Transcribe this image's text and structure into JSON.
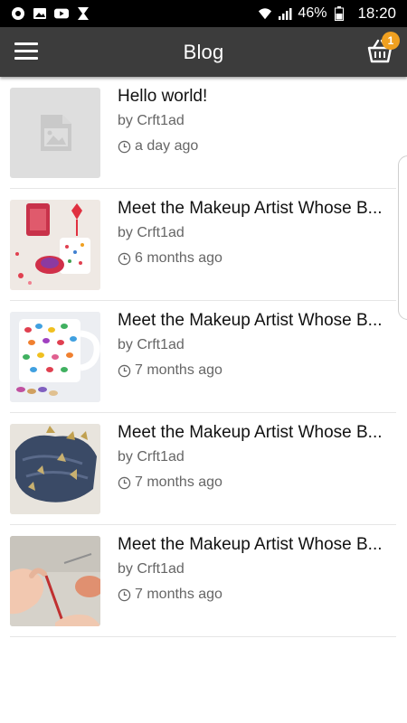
{
  "status_bar": {
    "battery": "46%",
    "time": "18:20"
  },
  "app_bar": {
    "title": "Blog",
    "cart_count": "1",
    "icons": [
      "menu-icon",
      "shopping-basket-icon"
    ]
  },
  "posts": [
    {
      "title": "Hello world!",
      "author": "by Crft1ad",
      "time": "a day ago",
      "thumbnail": "placeholder-image"
    },
    {
      "title": "Meet the Makeup Artist Whose B...",
      "author": "by Crft1ad",
      "time": "6 months ago",
      "thumbnail": "craft-mug-hearts"
    },
    {
      "title": "Meet the Makeup Artist Whose B...",
      "author": "by Crft1ad",
      "time": "7 months ago",
      "thumbnail": "painted-mug"
    },
    {
      "title": "Meet the Makeup Artist Whose B...",
      "author": "by Crft1ad",
      "time": "7 months ago",
      "thumbnail": "denim-bag"
    },
    {
      "title": "Meet the Makeup Artist Whose B...",
      "author": "by Crft1ad",
      "time": "7 months ago",
      "thumbnail": "hands-crafting"
    }
  ],
  "colors": {
    "app_bar": "#3c3c3c",
    "status_bar": "#000000",
    "badge": "#f0a020"
  }
}
